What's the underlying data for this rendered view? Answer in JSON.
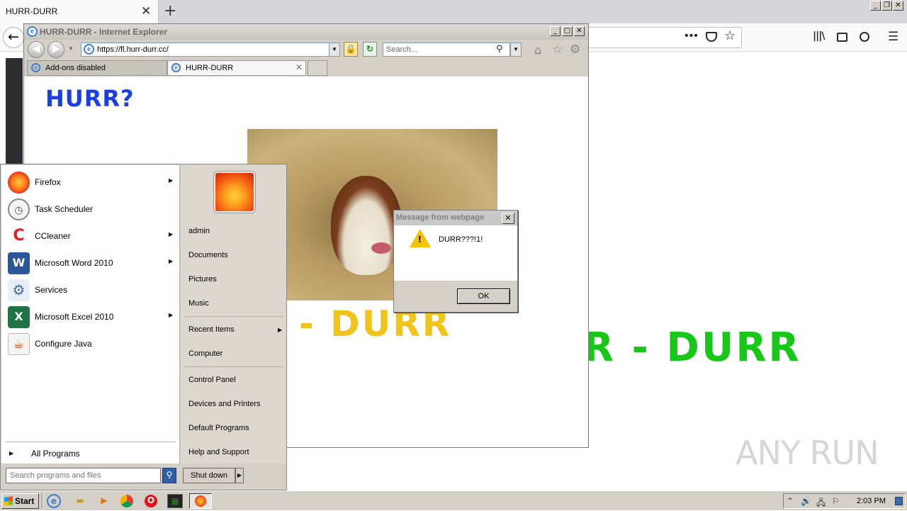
{
  "firefox": {
    "tab_title": "HURR-DURR",
    "tab_close_glyph": "✕",
    "new_tab_glyph": "+",
    "back_glyph": "←",
    "more_glyph": "•••",
    "star_glyph": "☆",
    "library_glyph": "|||\\",
    "menu_glyph": "☰",
    "window_controls": [
      "_",
      "❐",
      "✕"
    ]
  },
  "ie": {
    "window_title": "HURR-DURR - Internet Explorer",
    "window_controls": [
      "_",
      "□",
      "✕"
    ],
    "address": "https://fl.hurr-durr.cc/",
    "search_placeholder": "Search...",
    "tabs": [
      {
        "label": "Add-ons disabled"
      },
      {
        "label": "HURR-DURR"
      }
    ],
    "tab_close_glyph": "✕",
    "home_glyph": "⌂",
    "favorites_glyph": "☆",
    "tools_glyph": "⚙"
  },
  "page": {
    "heading": "HURR?",
    "durr_partial": "- DURR",
    "durr_big": "R - DURR",
    "accent_colors": {
      "heading": "#1b3fe0",
      "durr_partial": "#f0c419",
      "durr_big": "#18c818"
    }
  },
  "dialog": {
    "title": "Message from webpage",
    "message": "DURR???!1!",
    "ok_label": "OK",
    "close_glyph": "✕",
    "warning_glyph": "!"
  },
  "start_menu": {
    "programs": [
      {
        "label": "Firefox",
        "icon": "firefox-icon",
        "has_submenu": true
      },
      {
        "label": "Task Scheduler",
        "icon": "task-scheduler-icon",
        "has_submenu": false
      },
      {
        "label": "CCleaner",
        "icon": "ccleaner-icon",
        "has_submenu": true
      },
      {
        "label": "Microsoft Word 2010",
        "icon": "word-icon",
        "has_submenu": true
      },
      {
        "label": "Services",
        "icon": "services-icon",
        "has_submenu": false
      },
      {
        "label": "Microsoft Excel 2010",
        "icon": "excel-icon",
        "has_submenu": true
      },
      {
        "label": "Configure Java",
        "icon": "java-icon",
        "has_submenu": false
      }
    ],
    "all_programs": "All Programs",
    "search_placeholder": "Search programs and files",
    "right_items": {
      "user": "admin",
      "documents": "Documents",
      "pictures": "Pictures",
      "music": "Music",
      "recent": "Recent Items",
      "computer": "Computer",
      "control_panel": "Control Panel",
      "devices": "Devices and Printers",
      "default_programs": "Default Programs",
      "help": "Help and Support"
    },
    "shutdown": "Shut down",
    "arrow_glyph": "▶"
  },
  "taskbar": {
    "start_label": "Start",
    "clock": "2:03 PM"
  },
  "watermark": "ANY RUN"
}
